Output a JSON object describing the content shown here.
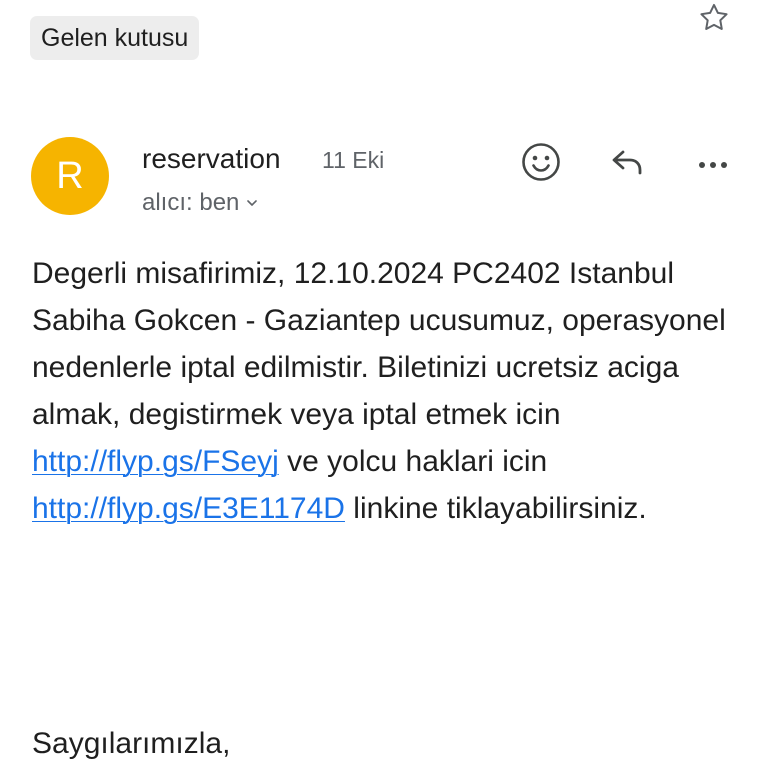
{
  "header": {
    "label_chip": "Gelen kutusu",
    "star_icon": "star-outline-icon"
  },
  "message": {
    "avatar_letter": "R",
    "avatar_color": "#f6b400",
    "sender": "reservation",
    "date": "11 Eki",
    "recipient": "alıcı: ben",
    "actions": {
      "emoji_icon": "smiley-icon",
      "reply_icon": "reply-icon",
      "more_icon": "more-horizontal-icon"
    },
    "body": {
      "text_1": "Degerli misafirimiz, 12.10.2024 PC2402 Istanbul Sabiha Gokcen - Gaziantep ucusumuz, operasyonel nedenlerle iptal edilmistir. Biletinizi ucretsiz aciga almak, degistirmek veya iptal etmek icin ",
      "link_1": "http://flyp.gs/FSeyj",
      "text_2": " ve yolcu haklari icin ",
      "link_2": "http://flyp.gs/E3E1174D",
      "text_3": " linkine tiklayabilirsiniz."
    },
    "sign_off": "Saygılarımızla,"
  },
  "colors": {
    "link": "#1a73e8",
    "secondary_text": "#5f6368",
    "chip_background": "#ededed"
  }
}
